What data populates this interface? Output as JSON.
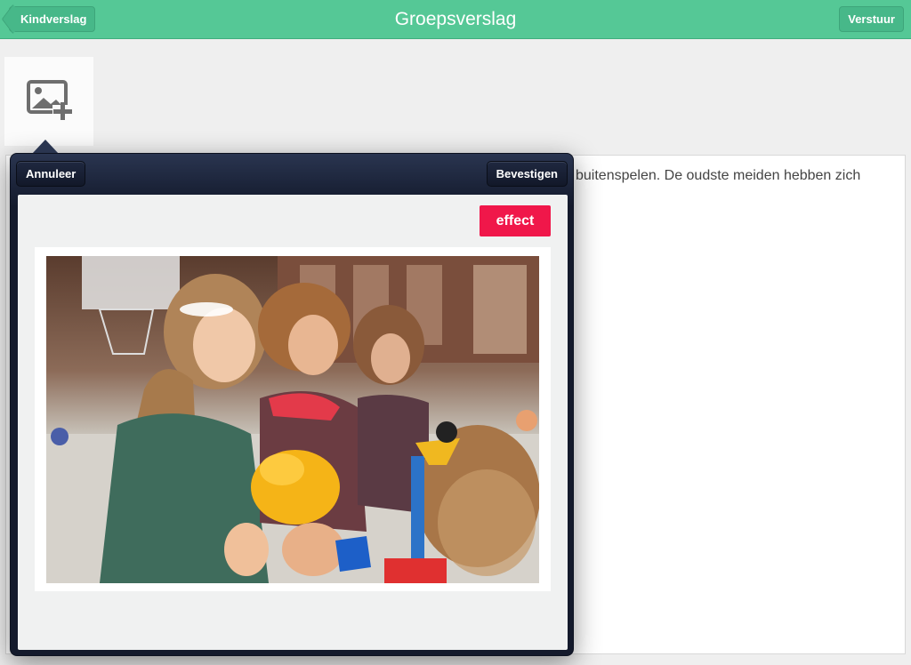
{
  "navbar": {
    "title": "Groepsverslag",
    "back_label": "Kindverslag",
    "send_label": "Verstuur",
    "color": "#55c896"
  },
  "photo_tile": {
    "icon": "add-photo-icon"
  },
  "report": {
    "visible_text": "buitenspelen. De oudste meiden hebben zich"
  },
  "popover": {
    "cancel_label": "Annuleer",
    "confirm_label": "Bevestigen",
    "effect_label": "effect",
    "effect_color": "#f0174a"
  }
}
